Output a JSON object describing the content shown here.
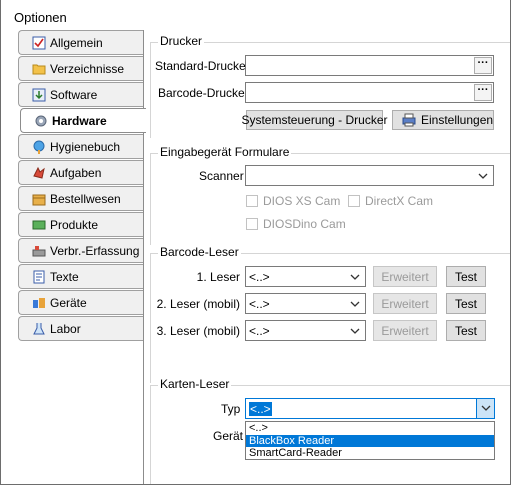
{
  "window": {
    "title": "Optionen"
  },
  "tabs": [
    {
      "label": "Allgemein",
      "icon": "checklist-icon",
      "active": false
    },
    {
      "label": "Verzeichnisse",
      "icon": "folder-icon",
      "active": false
    },
    {
      "label": "Software",
      "icon": "software-install-icon",
      "active": false
    },
    {
      "label": "Hardware",
      "icon": "gear-icon",
      "active": true
    },
    {
      "label": "Hygienebuch",
      "icon": "hygiene-icon",
      "active": false
    },
    {
      "label": "Aufgaben",
      "icon": "tasks-icon",
      "active": false
    },
    {
      "label": "Bestellwesen",
      "icon": "order-box-icon",
      "active": false
    },
    {
      "label": "Produkte",
      "icon": "products-icon",
      "active": false
    },
    {
      "label": "Verbr.-Erfassung",
      "icon": "consumption-icon",
      "active": false
    },
    {
      "label": "Texte",
      "icon": "document-icon",
      "active": false
    },
    {
      "label": "Geräte",
      "icon": "devices-icon",
      "active": false
    },
    {
      "label": "Labor",
      "icon": "lab-icon",
      "active": false
    }
  ],
  "drucker": {
    "title": "Drucker",
    "standard_label": "Standard-Drucker",
    "standard_value": "",
    "barcode_label": "Barcode-Drucker",
    "barcode_value": "",
    "browse_label": "...",
    "systemsteuerung_button": "Systemsteuerung - Drucker",
    "einstellungen_button": "Einstellungen"
  },
  "eingabe": {
    "title": "Eingabegerät Formulare",
    "scanner_label": "Scanner",
    "scanner_value": "",
    "options": [
      "DIOS XS Cam",
      "DirectX Cam",
      "DIOSDino Cam"
    ]
  },
  "barcode": {
    "title": "Barcode-Leser",
    "rows": [
      {
        "label": "1. Leser",
        "value": "<..>",
        "erweitert": "Erweitert",
        "test": "Test"
      },
      {
        "label": "2. Leser (mobil)",
        "value": "<..>",
        "erweitert": "Erweitert",
        "test": "Test"
      },
      {
        "label": "3. Leser (mobil)",
        "value": "<..>",
        "erweitert": "Erweitert",
        "test": "Test"
      }
    ]
  },
  "karten": {
    "title": "Karten-Leser",
    "typ_label": "Typ",
    "typ_value": "<..>",
    "geraet_label": "Gerät",
    "dropdown_options": [
      "<..>",
      "BlackBox Reader",
      "SmartCard-Reader"
    ],
    "dropdown_selected": "BlackBox Reader"
  }
}
